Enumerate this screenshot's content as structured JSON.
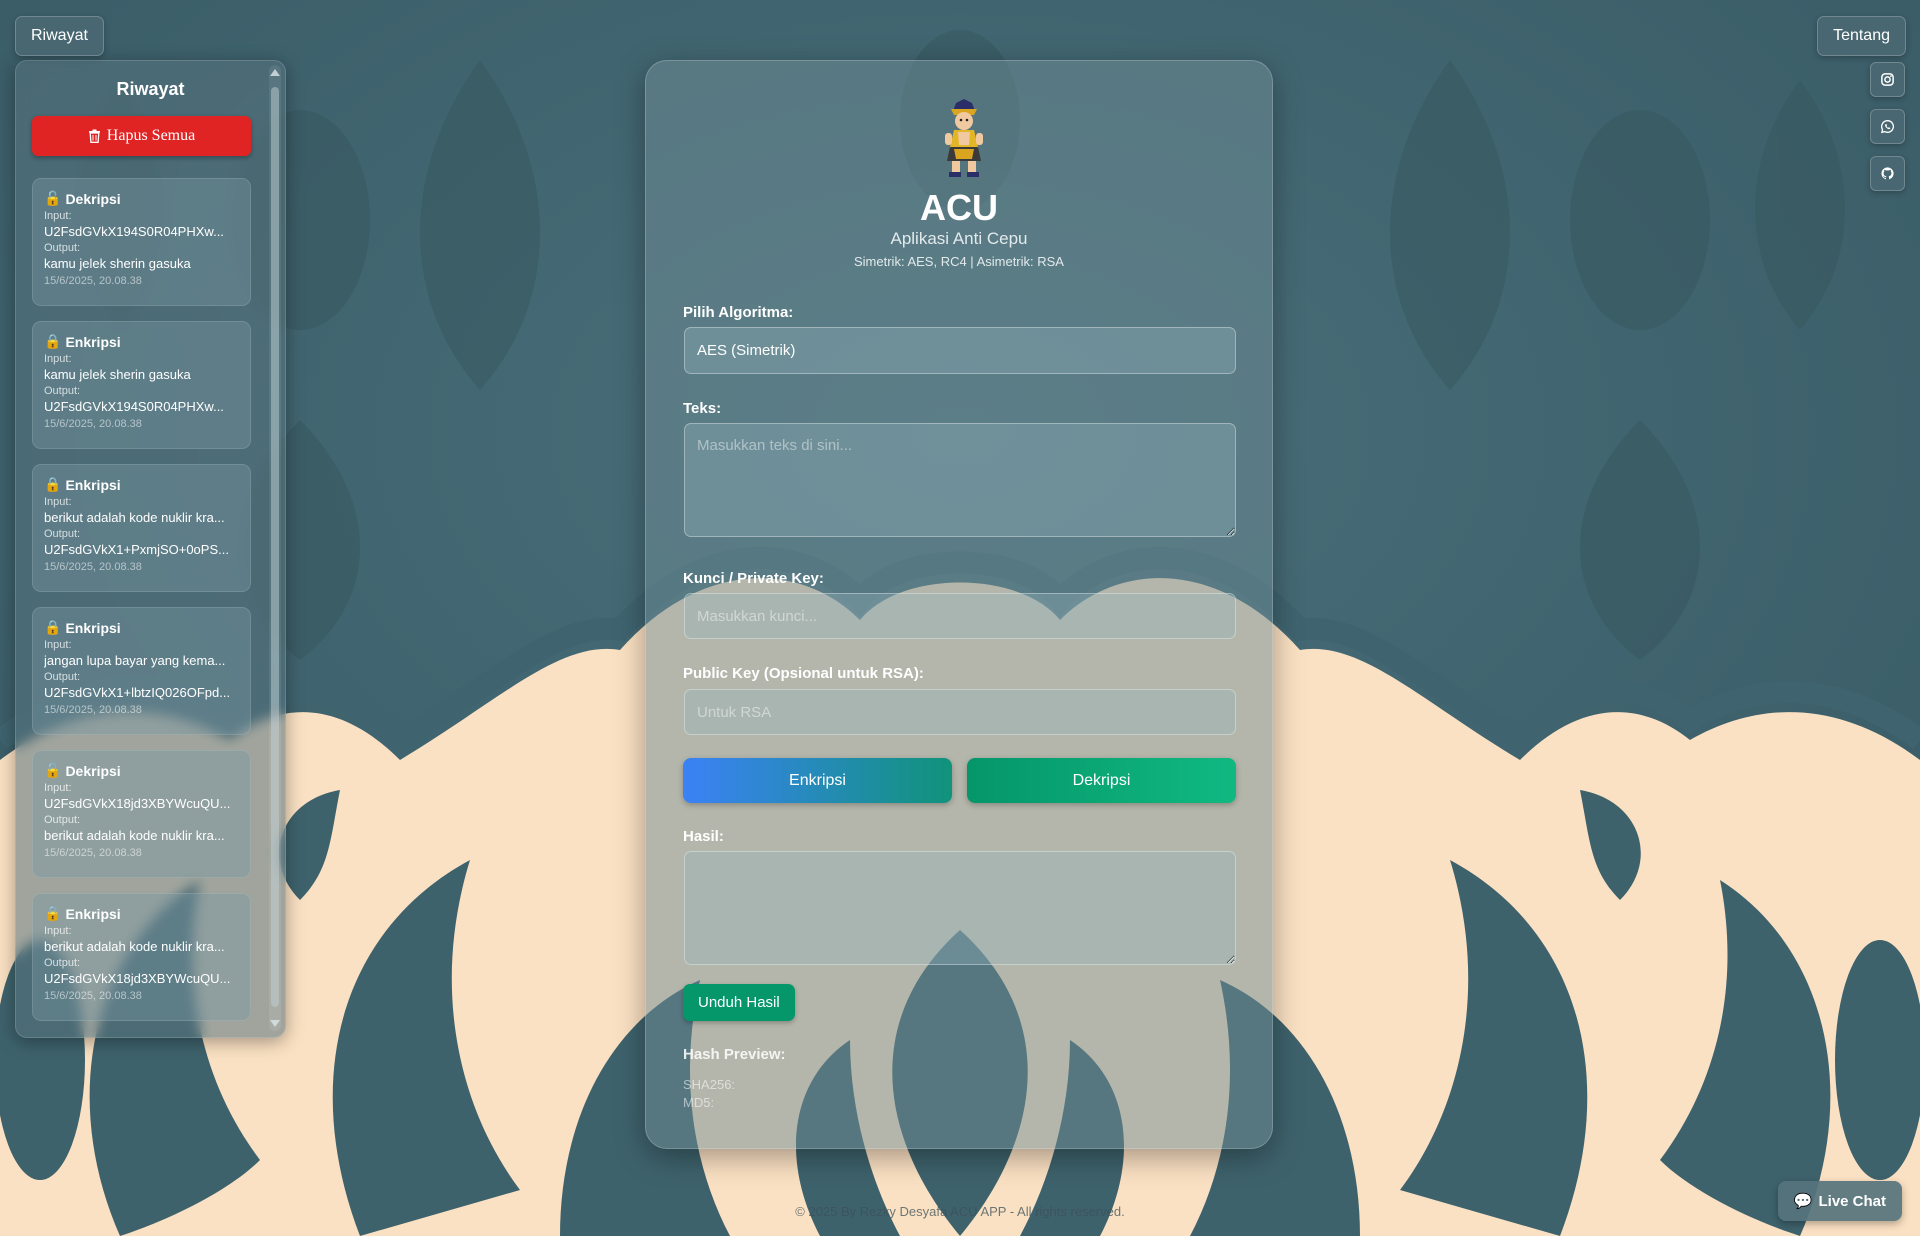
{
  "topbar": {
    "history_button": "Riwayat",
    "about_button": "Tentang"
  },
  "social": [
    "instagram-icon",
    "whatsapp-icon",
    "github-icon"
  ],
  "sidebar": {
    "title": "Riwayat",
    "clear_all_label": "Hapus Semua",
    "items": [
      {
        "type": "Dekripsi",
        "icon": "unlock-icon",
        "input_label": "Input:",
        "input": "U2FsdGVkX194S0R04PHXw...",
        "output_label": "Output:",
        "output": "kamu jelek sherin gasuka",
        "time": "15/6/2025, 20.08.38"
      },
      {
        "type": "Enkripsi",
        "icon": "lock-icon",
        "input_label": "Input:",
        "input": "kamu jelek sherin gasuka",
        "output_label": "Output:",
        "output": "U2FsdGVkX194S0R04PHXw...",
        "time": "15/6/2025, 20.08.38"
      },
      {
        "type": "Enkripsi",
        "icon": "lock-icon",
        "input_label": "Input:",
        "input": "berikut adalah kode nuklir kra...",
        "output_label": "Output:",
        "output": "U2FsdGVkX1+PxmjSO+0oPS...",
        "time": "15/6/2025, 20.08.38"
      },
      {
        "type": "Enkripsi",
        "icon": "lock-icon",
        "input_label": "Input:",
        "input": "jangan lupa bayar yang kema...",
        "output_label": "Output:",
        "output": "U2FsdGVkX1+lbtzIQ026OFpd...",
        "time": "15/6/2025, 20.08.38"
      },
      {
        "type": "Dekripsi",
        "icon": "unlock-icon",
        "input_label": "Input:",
        "input": "U2FsdGVkX18jd3XBYWcuQU...",
        "output_label": "Output:",
        "output": "berikut adalah kode nuklir kra...",
        "time": "15/6/2025, 20.08.38"
      },
      {
        "type": "Enkripsi",
        "icon": "lock-icon",
        "input_label": "Input:",
        "input": "berikut adalah kode nuklir kra...",
        "output_label": "Output:",
        "output": "U2FsdGVkX18jd3XBYWcuQU...",
        "time": "15/6/2025, 20.08.38"
      }
    ]
  },
  "main": {
    "title": "ACU",
    "subtitle": "Aplikasi Anti Cepu",
    "algorithms": "Simetrik: AES, RC4 | Asimetrik: RSA",
    "algorithm_label": "Pilih Algoritma:",
    "algorithm_value": "AES (Simetrik)",
    "text_label": "Teks:",
    "text_placeholder": "Masukkan teks di sini...",
    "text_value": "",
    "key_label": "Kunci / Private Key:",
    "key_placeholder": "Masukkan kunci...",
    "key_value": "",
    "public_key_label": "Public Key (Opsional untuk RSA):",
    "public_key_placeholder": "Untuk RSA",
    "public_key_value": "",
    "encrypt_button": "Enkripsi",
    "decrypt_button": "Dekripsi",
    "result_label": "Hasil:",
    "result_value": "",
    "download_button": "Unduh Hasil",
    "hash_title": "Hash Preview:",
    "sha256_label": "SHA256:",
    "md5_label": "MD5:"
  },
  "footer": "© 2025 By Rezky Desyafa ACU APP - All rights reserved.",
  "live_chat": "Live Chat",
  "colors": {
    "background_teal": "#3f6470",
    "ornament_cream": "#fbe1c3",
    "clear_red": "#e02424",
    "encrypt_blue": "#3b82f6",
    "decrypt_green": "#10b981",
    "download_green": "#059669"
  }
}
